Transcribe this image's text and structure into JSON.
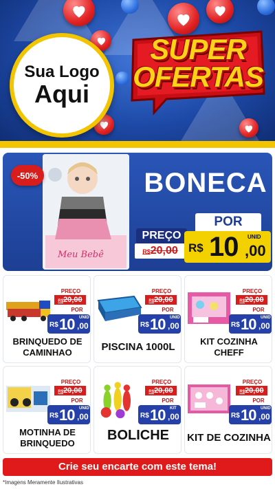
{
  "header": {
    "logo_line1": "Sua Logo",
    "logo_line2": "Aqui",
    "badge_line1": "SUPER",
    "badge_line2": "OFERTAS"
  },
  "hero": {
    "discount": "-50%",
    "title": "BONECA",
    "preco_label": "PREÇO",
    "old_currency": "R$",
    "old_price": "20,00",
    "por_label": "POR",
    "currency": "R$",
    "price_int": "10",
    "price_dec": ",00",
    "unit": "UNID",
    "box_brand": "Meu Bebê"
  },
  "products": [
    {
      "name": "BRINQUEDO DE CAMINHAO",
      "preco_label": "PREÇO",
      "old_currency": "R$",
      "old_price": "20,00",
      "por_label": "POR",
      "currency": "R$",
      "price_int": "10",
      "price_dec": ",00",
      "unit": "UNID"
    },
    {
      "name": "PISCINA 1000L",
      "preco_label": "PREÇO",
      "old_currency": "R$",
      "old_price": "20,00",
      "por_label": "POR",
      "currency": "R$",
      "price_int": "10",
      "price_dec": ",00",
      "unit": "UNID"
    },
    {
      "name": "KIT COZINHA CHEFF",
      "preco_label": "PREÇO",
      "old_currency": "R$",
      "old_price": "20,00",
      "por_label": "POR",
      "currency": "R$",
      "price_int": "10",
      "price_dec": ",00",
      "unit": "UNID"
    },
    {
      "name": "MOTINHA DE BRINQUEDO",
      "preco_label": "PREÇO",
      "old_currency": "R$",
      "old_price": "20,00",
      "por_label": "POR",
      "currency": "R$",
      "price_int": "10",
      "price_dec": ",00",
      "unit": "UNID"
    },
    {
      "name": "BOLICHE",
      "preco_label": "PREÇO",
      "old_currency": "R$",
      "old_price": "20,00",
      "por_label": "POR",
      "currency": "R$",
      "price_int": "10",
      "price_dec": ",00",
      "unit": "KIT"
    },
    {
      "name": "KIT DE COZINHA",
      "preco_label": "PREÇO",
      "old_currency": "R$",
      "old_price": "20,00",
      "por_label": "POR",
      "currency": "R$",
      "price_int": "10",
      "price_dec": ",00",
      "unit": "UNID"
    }
  ],
  "footer": {
    "cta_label": "Crie seu encarte com este tema!",
    "disclaimer": "*Imagens Meramente Ilustrativas"
  },
  "colors": {
    "header_blue": "#1d49a6",
    "accent_yellow": "#f3c400",
    "price_blue": "#2540a8",
    "sale_red": "#d81d1d"
  }
}
